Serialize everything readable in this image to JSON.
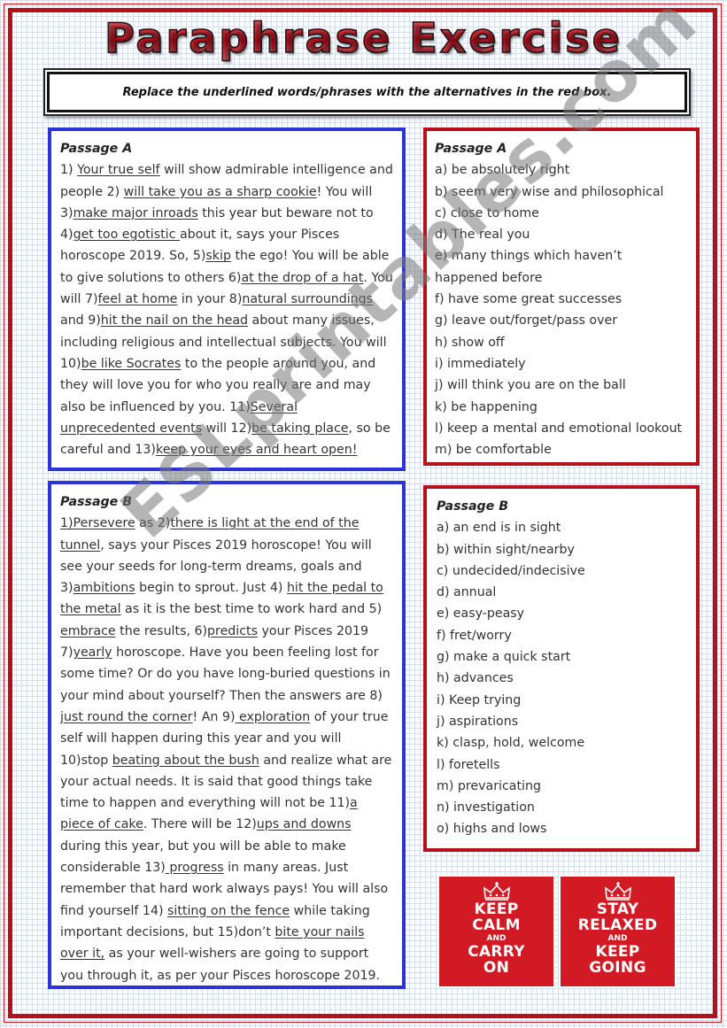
{
  "title": "Paraphrase Exercise",
  "instruction": "Replace the underlined words/phrases with the alternatives in the red box.",
  "passage_a": {
    "heading": "Passage A",
    "segments": [
      {
        "t": "1) "
      },
      {
        "t": "Your true self",
        "u": true
      },
      {
        "t": " will show admirable intelligence and people 2) "
      },
      {
        "t": "will take you as a sharp cookie",
        "u": true
      },
      {
        "t": "! You will 3)"
      },
      {
        "t": "make major inroads",
        "u": true
      },
      {
        "t": " this year but beware not to 4)"
      },
      {
        "t": "get too egotistic ",
        "u": true
      },
      {
        "t": "about it, says your Pisces horoscope 2019. So, 5)"
      },
      {
        "t": "skip",
        "u": true
      },
      {
        "t": " the ego! You will be able to give solutions to others 6)"
      },
      {
        "t": "at the drop of a hat",
        "u": true
      },
      {
        "t": ". You will 7)"
      },
      {
        "t": "feel at home",
        "u": true
      },
      {
        "t": " in your 8)"
      },
      {
        "t": "natural surroundings",
        "u": true
      },
      {
        "t": " and 9)"
      },
      {
        "t": "hit the nail on the head",
        "u": true
      },
      {
        "t": " about many issues, including religious and intellectual subjects. You will 10)"
      },
      {
        "t": "be like Socrates",
        "u": true
      },
      {
        "t": " to the people around you, and they will love you for who you really are and may also be influenced by you. 11)"
      },
      {
        "t": "Several unprecedented events",
        "u": true
      },
      {
        "t": " will 12)"
      },
      {
        "t": "be taking place",
        "u": true
      },
      {
        "t": ", so be careful and 13)"
      },
      {
        "t": "keep your eyes and heart open!",
        "u": true
      }
    ]
  },
  "options_a": {
    "heading": "Passage A",
    "items": [
      "a) be absolutely right",
      "b) seem very wise and philosophical",
      "c) close to home",
      "d) The real you",
      "e) many things which haven’t happened before",
      "f)  have some great successes",
      "g) leave out/forget/pass over",
      "h) show off",
      "i) immediately",
      "j) will think you are on the ball",
      "k) be happening",
      "l) keep a mental and emotional lookout",
      "m) be comfortable"
    ]
  },
  "passage_b": {
    "heading": "Passage B",
    "segments": [
      {
        "t": "1)Persevere",
        "u": true
      },
      {
        "t": " as 2)"
      },
      {
        "t": "there is light at the end of the tunnel",
        "u": true
      },
      {
        "t": ", says your Pisces 2019 horoscope! You will see your seeds for long-term dreams, goals and 3)"
      },
      {
        "t": "ambitions",
        "u": true
      },
      {
        "t": " begin to sprout. Just 4) "
      },
      {
        "t": "hit the pedal to the metal",
        "u": true
      },
      {
        "t": " as it is the best time to work hard and 5) "
      },
      {
        "t": "embrace",
        "u": true
      },
      {
        "t": " the results, 6)"
      },
      {
        "t": "predicts",
        "u": true
      },
      {
        "t": " your Pisces 2019 7)"
      },
      {
        "t": "yearly",
        "u": true
      },
      {
        "t": " horoscope. Have you been feeling lost for some time? Or do you have long-buried questions in your mind about yourself? Then the answers are 8) "
      },
      {
        "t": "just round the corner",
        "u": true
      },
      {
        "t": "! An 9)"
      },
      {
        "t": " exploration",
        "u": true
      },
      {
        "t": " of your true self will happen during this year and you will 10)stop "
      },
      {
        "t": "beating about the bush",
        "u": true
      },
      {
        "t": " and realize what are your actual needs. It is said that good things take time to happen and everything will not be 11)"
      },
      {
        "t": "a piece of cake",
        "u": true
      },
      {
        "t": ". There will be 12)"
      },
      {
        "t": "ups and downs",
        "u": true
      },
      {
        "t": " during this year, but you will be able to make considerable 13)"
      },
      {
        "t": " progress",
        "u": true
      },
      {
        "t": " in many areas. Just remember that hard work always pays! You will also find yourself 14) "
      },
      {
        "t": "sitting on the fence",
        "u": true
      },
      {
        "t": " while taking important decisions, but 15)don’t "
      },
      {
        "t": "bite your nails over it,",
        "u": true
      },
      {
        "t": " as your well-wishers are going to support you through it, as per your Pisces horoscope 2019."
      }
    ]
  },
  "options_b": {
    "heading": "Passage B",
    "items": [
      "a) an end is in sight",
      "b) within sight/nearby",
      "c) undecided/indecisive",
      "d) annual",
      "e) easy-peasy",
      "f) fret/worry",
      "g) make a quick start",
      "h) advances",
      "i) Keep trying",
      "j) aspirations",
      "k) clasp, hold, welcome",
      "l) foretells",
      "m) prevaricating",
      "n) investigation",
      "o) highs and lows"
    ]
  },
  "posters": [
    {
      "icon": "crown-icon",
      "lines": [
        {
          "t": "KEEP",
          "size": "big"
        },
        {
          "t": "CALM",
          "size": "big"
        },
        {
          "t": "AND",
          "size": "small"
        },
        {
          "t": "CARRY",
          "size": "big"
        },
        {
          "t": "ON",
          "size": "big"
        }
      ]
    },
    {
      "icon": "crown-icon",
      "lines": [
        {
          "t": "STAY",
          "size": "big"
        },
        {
          "t": "RELAXED",
          "size": "big"
        },
        {
          "t": "AND",
          "size": "small"
        },
        {
          "t": "KEEP",
          "size": "big"
        },
        {
          "t": "GOING",
          "size": "big"
        }
      ]
    }
  ],
  "watermark": "ESLprintables.com",
  "colors": {
    "frame_red": "#b8101a",
    "passage_blue": "#2b34d9",
    "poster_red": "#d11a23"
  }
}
